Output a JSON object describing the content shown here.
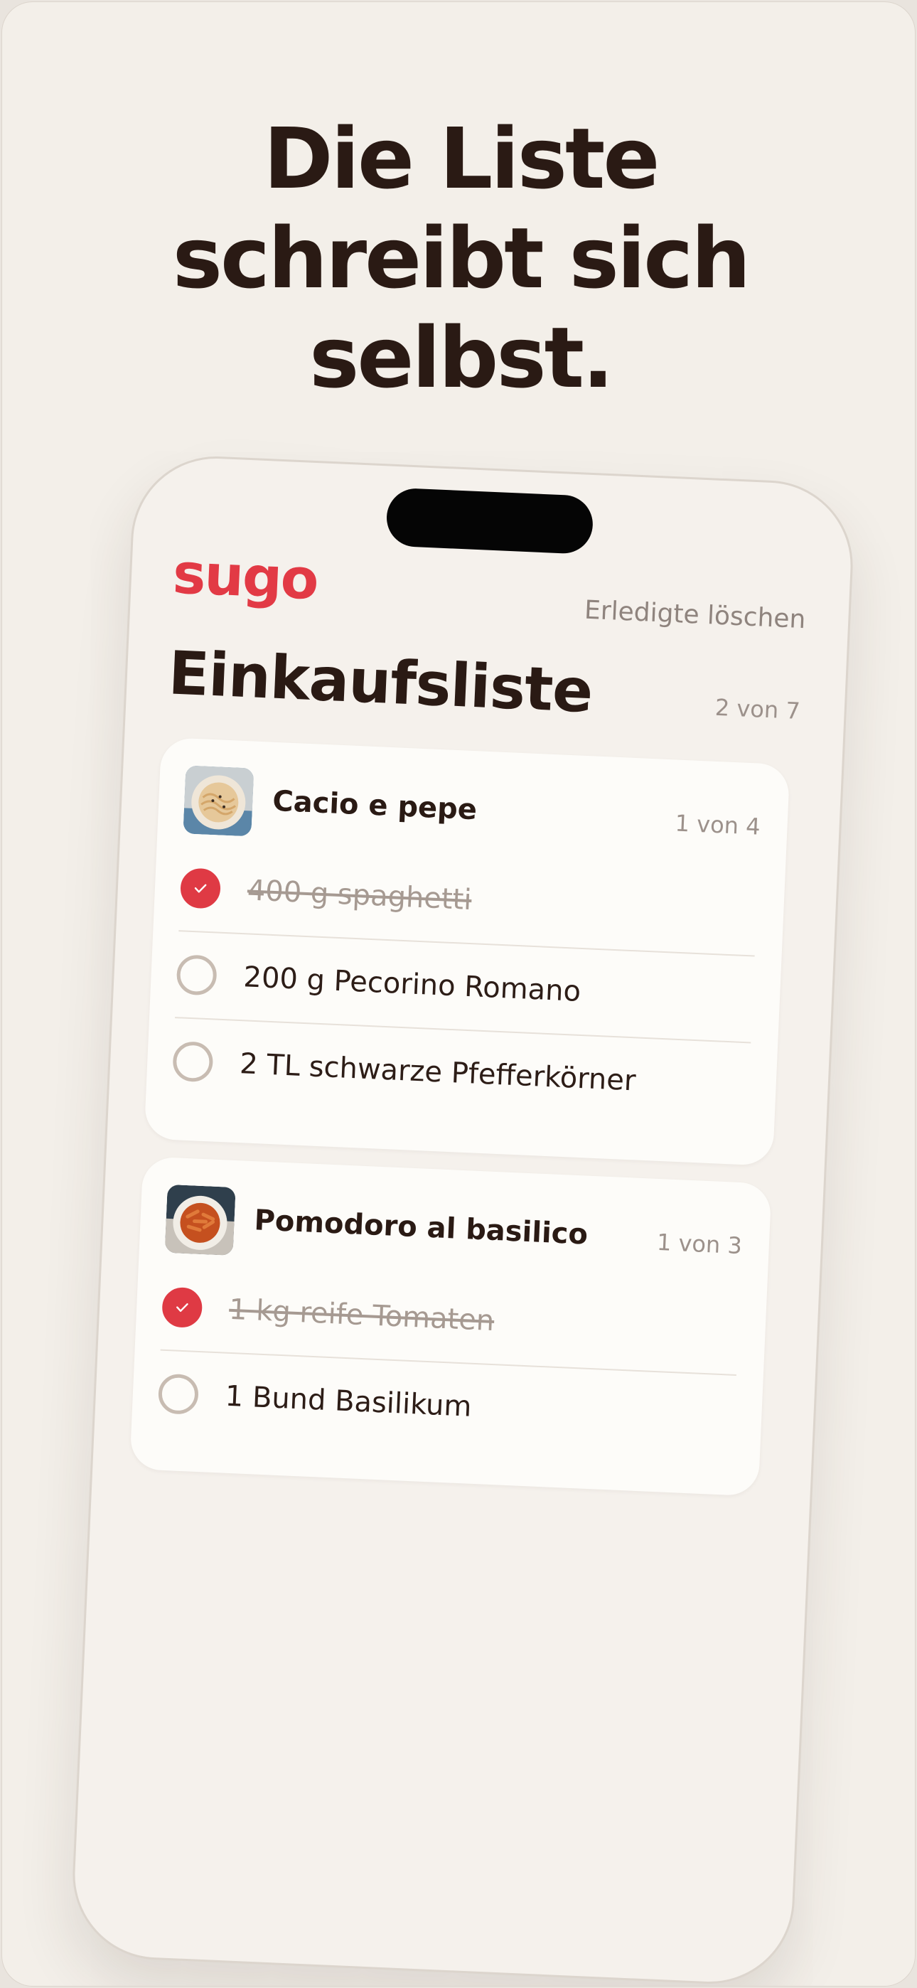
{
  "headline": [
    "Die Liste",
    "schreibt sich",
    "selbst."
  ],
  "app": {
    "logo": "sugo",
    "clear_completed": "Erledigte löschen",
    "title": "Einkaufsliste",
    "overall_count": "2 von 7"
  },
  "recipes": [
    {
      "name": "Cacio e pepe",
      "count": "1 von 4",
      "image_icon": "pasta-photo",
      "items": [
        {
          "text": "400 g spaghetti",
          "done": true
        },
        {
          "text": "200 g Pecorino Romano",
          "done": false
        },
        {
          "text": "2 TL schwarze Pfefferkörner",
          "done": false
        }
      ]
    },
    {
      "name": "Pomodoro al basilico",
      "count": "1 von 3",
      "image_icon": "penne-photo",
      "items": [
        {
          "text": "1 kg reife Tomaten",
          "done": true
        },
        {
          "text": "1 Bund Basilikum",
          "done": false
        }
      ]
    }
  ],
  "colors": {
    "accent": "#df3a44",
    "background": "#f3efe9",
    "card": "#fdfcf9",
    "text": "#2a1a14",
    "muted": "#9c918b"
  }
}
